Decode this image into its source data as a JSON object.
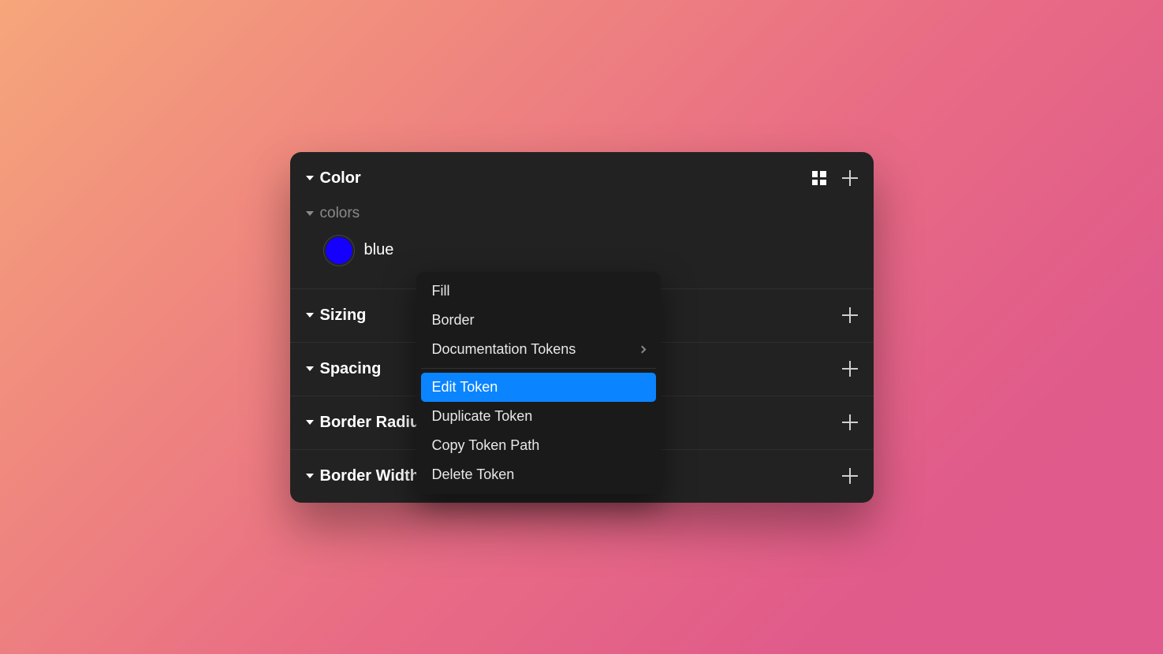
{
  "panel": {
    "sections": [
      {
        "title": "Color"
      },
      {
        "title": "Sizing"
      },
      {
        "title": "Spacing"
      },
      {
        "title": "Border Radius"
      },
      {
        "title": "Border Width"
      }
    ],
    "color_group": {
      "name": "colors",
      "tokens": [
        {
          "name": "blue",
          "value": "#1500ff"
        }
      ]
    }
  },
  "context_menu": {
    "groups": [
      [
        {
          "label": "Fill",
          "submenu": false
        },
        {
          "label": "Border",
          "submenu": false
        },
        {
          "label": "Documentation Tokens",
          "submenu": true
        }
      ],
      [
        {
          "label": "Edit Token",
          "submenu": false,
          "highlighted": true
        },
        {
          "label": "Duplicate Token",
          "submenu": false
        },
        {
          "label": "Copy Token Path",
          "submenu": false
        },
        {
          "label": "Delete Token",
          "submenu": false
        }
      ]
    ]
  },
  "icons": {
    "grid": "grid-view-icon",
    "plus": "add-icon",
    "caret_down": "caret-down-icon",
    "chevron_right": "chevron-right-icon"
  }
}
